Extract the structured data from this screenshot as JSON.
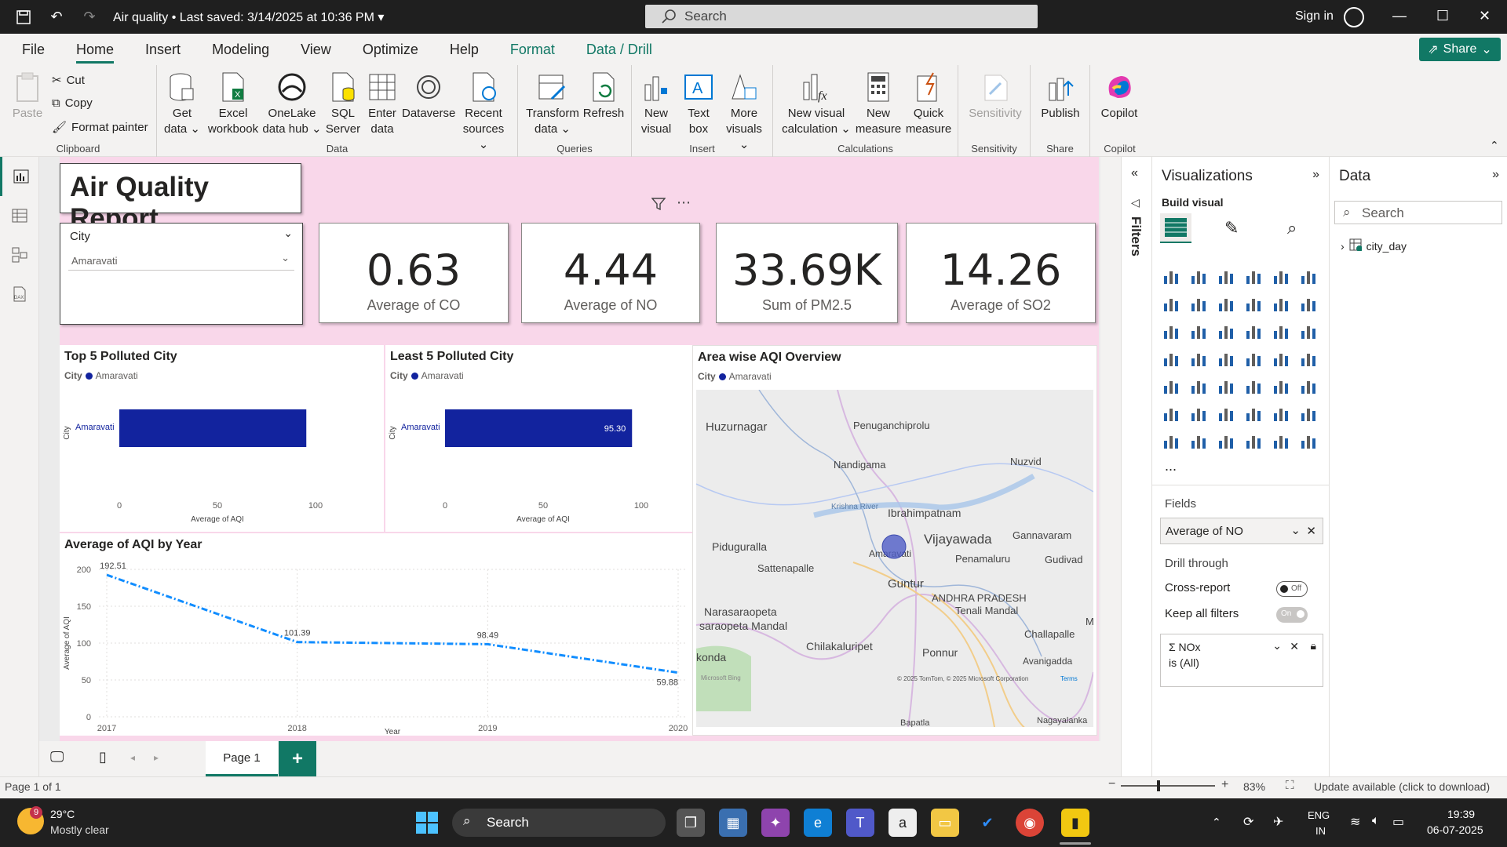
{
  "window": {
    "title": "Air quality",
    "saved": "Last saved: 3/14/2025 at 10:36 PM",
    "search_placeholder": "Search",
    "signin": "Sign in"
  },
  "menu": {
    "items": [
      "File",
      "Home",
      "Insert",
      "Modeling",
      "View",
      "Optimize",
      "Help",
      "Format",
      "Data / Drill"
    ],
    "share": "Share"
  },
  "ribbon": {
    "clipboard": {
      "paste": "Paste",
      "cut": "Cut",
      "copy": "Copy",
      "format_painter": "Format painter",
      "label": "Clipboard"
    },
    "data": {
      "get_data": "Get data",
      "excel": "Excel workbook",
      "onelake": "OneLake data hub",
      "sql": "SQL Server",
      "enter": "Enter data",
      "dataverse": "Dataverse",
      "recent": "Recent sources",
      "label": "Data"
    },
    "queries": {
      "transform": "Transform data",
      "refresh": "Refresh",
      "label": "Queries"
    },
    "insert": {
      "new_visual": "New visual",
      "text_box": "Text box",
      "more_visuals": "More visuals",
      "label": "Insert"
    },
    "calculations": {
      "new_visual_calc": "New visual calculation",
      "new_measure": "New measure",
      "quick_measure": "Quick measure",
      "label": "Calculations"
    },
    "sensitivity": {
      "btn": "Sensitivity",
      "label": "Sensitivity"
    },
    "share": {
      "publish": "Publish",
      "label": "Share"
    },
    "copilot": {
      "btn": "Copilot",
      "label": "Copilot"
    }
  },
  "report": {
    "title": "Air Quality Report",
    "slicer": {
      "label": "City",
      "value": "Amaravati"
    },
    "kpis": [
      {
        "value": "0.63",
        "label": "Average of CO"
      },
      {
        "value": "4.44",
        "label": "Average of NO"
      },
      {
        "value": "33.69K",
        "label": "Sum of PM2.5"
      },
      {
        "value": "14.26",
        "label": "Average of SO2"
      }
    ],
    "top5": {
      "title": "Top 5 Polluted City",
      "legend_label": "City",
      "legend_item": "Amaravati",
      "ylabel": "City",
      "xlabel": "Average of AQI"
    },
    "least5": {
      "title": "Least 5 Polluted City",
      "legend_label": "City",
      "legend_item": "Amaravati",
      "ylabel": "City",
      "xlabel": "Average of AQI",
      "data_label": "95.30"
    },
    "line": {
      "title": "Average of AQI by Year",
      "ylabel": "Average of AQI",
      "xlabel": "Year"
    },
    "map": {
      "title": "Area wise AQI Overview",
      "legend_label": "City",
      "legend_item": "Amaravati",
      "places": [
        "Huzurnagar",
        "Penuganchiprolu",
        "Nandigama",
        "Nuzvid",
        "Krishna River",
        "Ibrahimpatnam",
        "Vijayawada",
        "Gannavaram",
        "Piduguralla",
        "Amaravati",
        "Penamaluru",
        "Gudivad",
        "Sattenapalle",
        "Guntur",
        "ANDHRA PRADESH",
        "Narasaraopeta",
        "saraopeta Mandal",
        "Tenali Mandal",
        "Challapalle",
        "Chilakaluripet",
        "Ponnur",
        "Avanigadda",
        "konda",
        "M",
        "Bapatla",
        "Nagayalanka"
      ],
      "attribution": "© 2025 TomTom, © 2025 Microsoft Corporation",
      "terms": "Terms",
      "bing": "Microsoft Bing"
    }
  },
  "chart_data": [
    {
      "type": "bar",
      "title": "Top 5 Polluted City",
      "categories": [
        "Amaravati"
      ],
      "values": [
        95.3
      ],
      "xlabel": "Average of AQI",
      "ylabel": "City",
      "xlim": [
        0,
        100
      ],
      "ticks": [
        "0",
        "50",
        "100"
      ]
    },
    {
      "type": "bar",
      "title": "Least 5 Polluted City",
      "categories": [
        "Amaravati"
      ],
      "values": [
        95.3
      ],
      "xlabel": "Average of AQI",
      "ylabel": "City",
      "xlim": [
        0,
        100
      ],
      "ticks": [
        "0",
        "50",
        "100"
      ]
    },
    {
      "type": "line",
      "title": "Average of AQI by Year",
      "x": [
        "2017",
        "2018",
        "2019",
        "2020"
      ],
      "values": [
        192.51,
        101.39,
        98.49,
        59.88
      ],
      "labels": [
        "192.51",
        "101.39",
        "98.49",
        "59.88"
      ],
      "xlabel": "Year",
      "ylabel": "Average of AQI",
      "ylim": [
        0,
        200
      ],
      "yticks": [
        "0",
        "50",
        "100",
        "150",
        "200"
      ]
    }
  ],
  "filters": {
    "label": "Filters"
  },
  "visualizations": {
    "title": "Visualizations",
    "build_visual": "Build visual",
    "fields_label": "Fields",
    "field_value": "Average of NO",
    "drill_through": "Drill through",
    "cross_report": "Cross-report",
    "cross_report_state": "Off",
    "keep_filters": "Keep all filters",
    "keep_filters_state": "On",
    "filter_field": "NOx",
    "filter_cond": "is (All)",
    "more": "..."
  },
  "datapane": {
    "title": "Data",
    "search_placeholder": "Search",
    "table": "city_day"
  },
  "pages": {
    "page1": "Page 1",
    "add": "+"
  },
  "status": {
    "page": "Page 1 of 1",
    "zoom": "83%",
    "update": "Update available (click to download)"
  },
  "taskbar": {
    "weather_temp": "29°C",
    "weather_desc": "Mostly clear",
    "weather_badge": "9",
    "search": "Search",
    "lang1": "ENG",
    "lang2": "IN",
    "time": "19:39",
    "date": "06-07-2025"
  },
  "colors": {
    "accent": "#117865",
    "bar": "#12239e",
    "line": "#118dff",
    "canvas": "#f9d7ea"
  }
}
